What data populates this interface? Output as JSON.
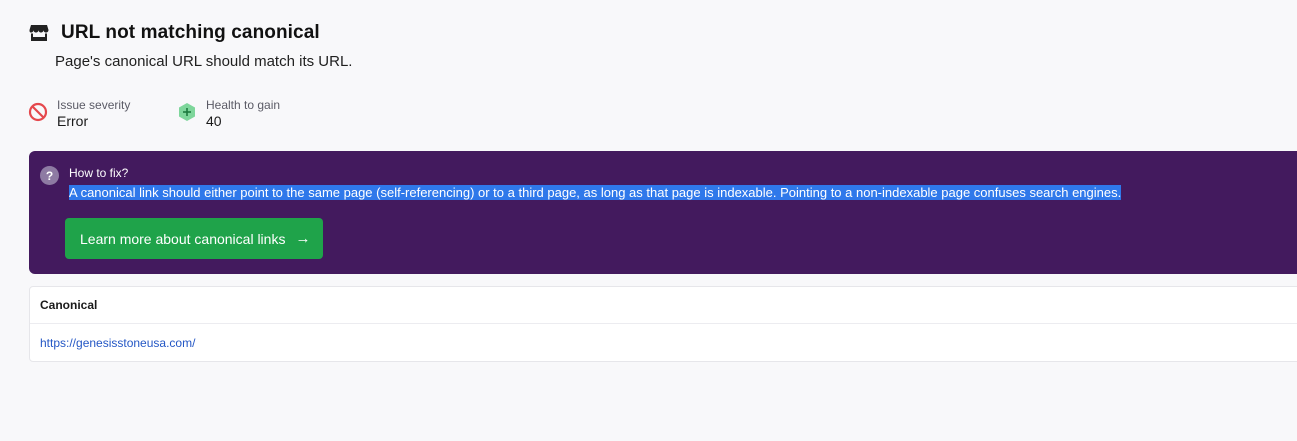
{
  "issue": {
    "title": "URL not matching canonical",
    "description": "Page's canonical URL should match its URL.",
    "icon": "store-icon"
  },
  "meta": {
    "severity": {
      "label": "Issue severity",
      "value": "Error",
      "icon": "no-entry-icon",
      "color": "#e5484d"
    },
    "health": {
      "label": "Health to gain",
      "value": "40",
      "icon": "plus-hexagon-icon",
      "color": "#7ed69b"
    }
  },
  "how_to_fix": {
    "heading": "How to fix?",
    "text": "A canonical link should either point to the same page (self-referencing) or to a third page, as long as that page is indexable. Pointing to a non-indexable page confuses search engines.",
    "button_label": "Learn more about canonical links",
    "button_arrow": "→",
    "panel_color": "#431a5e",
    "button_color": "#1fa34a"
  },
  "table": {
    "header": "Canonical",
    "rows": [
      "https://genesisstoneusa.com/"
    ]
  }
}
